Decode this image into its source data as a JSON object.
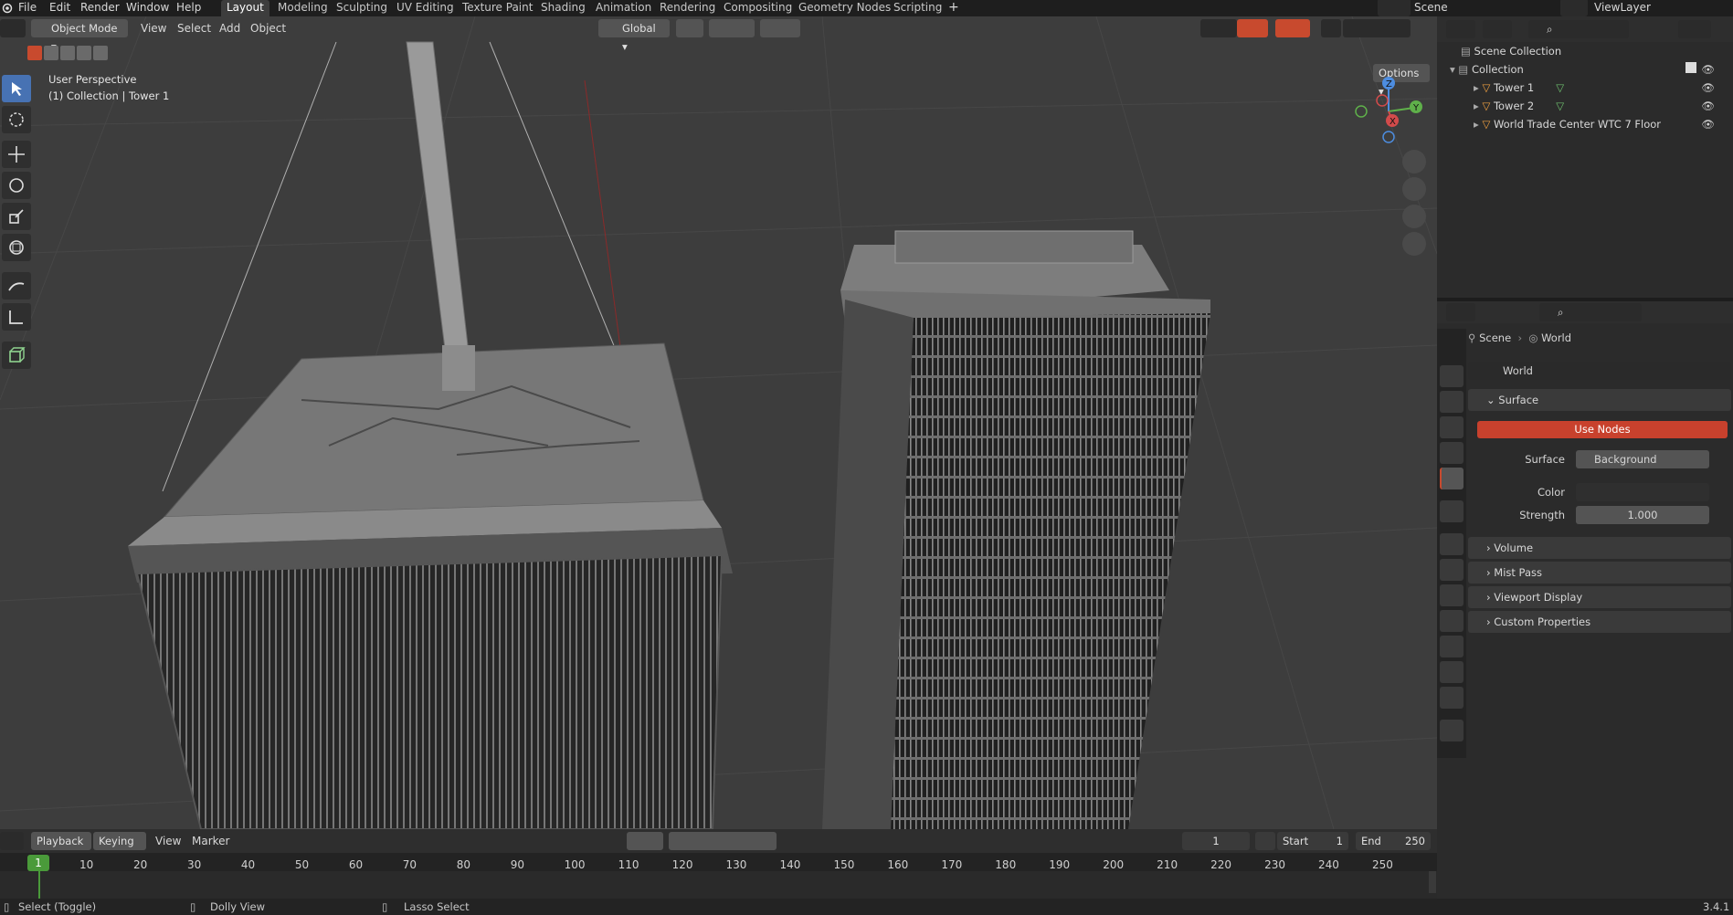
{
  "menubar": {
    "items": [
      "File",
      "Edit",
      "Render",
      "Window",
      "Help"
    ],
    "workspaces": [
      "Layout",
      "Modeling",
      "Sculpting",
      "UV Editing",
      "Texture Paint",
      "Shading",
      "Animation",
      "Rendering",
      "Compositing",
      "Geometry Nodes",
      "Scripting"
    ],
    "active_workspace": "Layout",
    "scene": "Scene",
    "view_layer": "ViewLayer"
  },
  "viewport_header": {
    "mode": "Object Mode",
    "menus": [
      "View",
      "Select",
      "Add",
      "Object"
    ],
    "orientation": "Global",
    "options_label": "Options"
  },
  "viewport": {
    "perspective_label": "User Perspective",
    "context_label": "(1) Collection | Tower 1",
    "gizmo_axes": [
      "Z",
      "Y",
      "X"
    ]
  },
  "outliner": {
    "root": "Scene Collection",
    "collection": "Collection",
    "objects": [
      "Tower 1",
      "Tower 2",
      "World Trade Center WTC 7 Floor"
    ]
  },
  "properties": {
    "breadcrumb": [
      "Scene",
      "World"
    ],
    "datablock_name": "World",
    "surface_panel": "Surface",
    "use_nodes_button": "Use Nodes",
    "surface_label": "Surface",
    "surface_value": "Background",
    "color_label": "Color",
    "strength_label": "Strength",
    "strength_value": "1.000",
    "collapsed_panels": [
      "Volume",
      "Mist Pass",
      "Viewport Display",
      "Custom Properties"
    ],
    "accent_color": "#c8412d"
  },
  "timeline": {
    "menus": [
      "Playback",
      "Keying",
      "View",
      "Marker"
    ],
    "current_frame": "1",
    "start_label": "Start",
    "start_value": "1",
    "end_label": "End",
    "end_value": "250",
    "ruler_ticks": [
      "1",
      "10",
      "20",
      "30",
      "40",
      "50",
      "60",
      "70",
      "80",
      "90",
      "100",
      "110",
      "120",
      "130",
      "140",
      "150",
      "160",
      "170",
      "180",
      "190",
      "200",
      "210",
      "220",
      "230",
      "240",
      "250"
    ]
  },
  "statusbar": {
    "hints": [
      "Select (Toggle)",
      "Dolly View",
      "Lasso Select"
    ],
    "version": "3.4.1"
  }
}
